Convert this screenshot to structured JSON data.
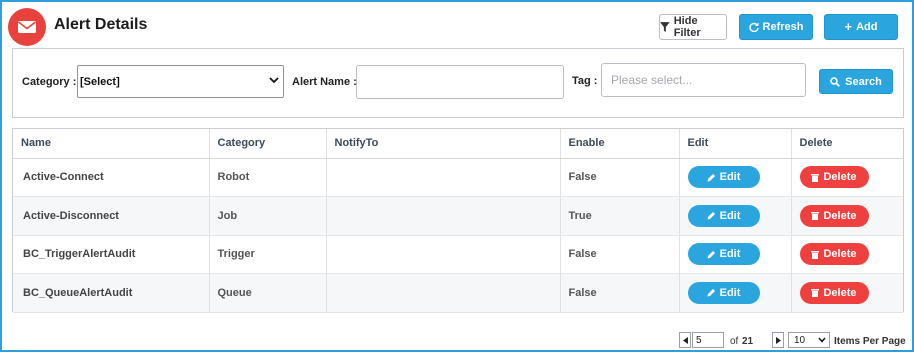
{
  "header": {
    "title": "Alert Details",
    "icon": "envelope-icon",
    "icon_color": "#e8423f"
  },
  "toolbar": {
    "hide_filter_label": "Hide Filter",
    "refresh_label": "Refresh",
    "add_label": "Add",
    "accent_color": "#2aa5de"
  },
  "filters": {
    "category_label": "Category :",
    "category_value": "[Select]",
    "alert_name_label": "Alert Name :",
    "alert_name_value": "",
    "tag_label": "Tag :",
    "tag_placeholder": "Please select...",
    "search_label": "Search"
  },
  "table": {
    "columns": [
      "Name",
      "Category",
      "NotifyTo",
      "Enable",
      "Edit",
      "Delete"
    ],
    "rows": [
      {
        "name": "Active-Connect",
        "category": "Robot",
        "notify_to": "",
        "enable": "False"
      },
      {
        "name": "Active-Disconnect",
        "category": "Job",
        "notify_to": "",
        "enable": "True"
      },
      {
        "name": "BC_TriggerAlertAudit",
        "category": "Trigger",
        "notify_to": "",
        "enable": "False"
      },
      {
        "name": "BC_QueueAlertAudit",
        "category": "Queue",
        "notify_to": "",
        "enable": "False"
      }
    ],
    "edit_label": "Edit",
    "delete_label": "Delete",
    "delete_color": "#ef4040"
  },
  "pagination": {
    "current_page": "5",
    "of_label": "of",
    "total_pages": "21",
    "items_per_page": "10",
    "items_per_page_label": "Items Per Page"
  }
}
